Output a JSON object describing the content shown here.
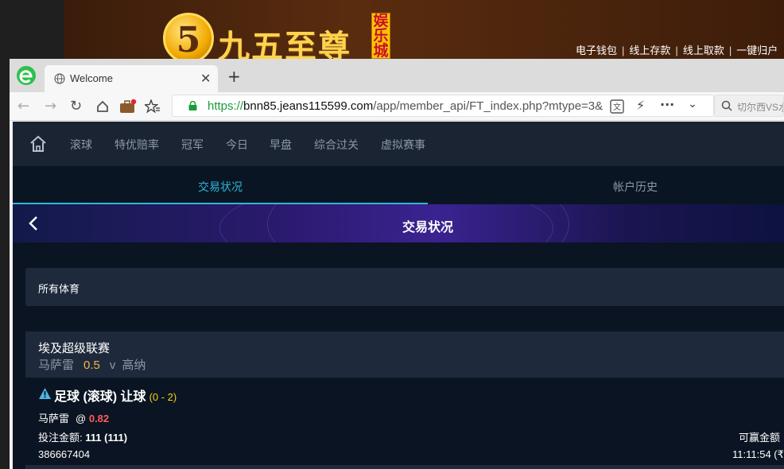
{
  "background_site": {
    "logo_numeral": "5",
    "logo_text": "九五至尊",
    "logo_badge": "娱乐城",
    "links": [
      "电子钱包",
      "线上存款",
      "线上取款",
      "一键归户"
    ]
  },
  "browser": {
    "tab_title": "Welcome",
    "url_scheme": "https://",
    "url_host": "bnn85.jeans115599.com",
    "url_path": "/app/member_api/FT_index.php?mtype=3&",
    "search_placeholder": "切尔西VS水"
  },
  "nav": {
    "items": [
      "滚球",
      "特优赔率",
      "冠军",
      "今日",
      "早盘",
      "综合过关",
      "虚拟赛事"
    ]
  },
  "tabs": {
    "active": "交易状况",
    "history": "帐户历史"
  },
  "header": {
    "title": "交易状况"
  },
  "filter": {
    "label": "所有体育"
  },
  "bet": {
    "league": "埃及超级联赛",
    "home_team": "马萨雷",
    "handicap": "0.5",
    "vs": "v",
    "away_team": "高纳",
    "title": "足球 (滚球) 让球",
    "score": "(0 - 2)",
    "selection": "马萨雷",
    "at": "@",
    "odds": "0.82",
    "stake_label": "投注金额:",
    "stake_value": "111 (111)",
    "ticket_id": "386667404",
    "win_label": "可赢金额",
    "time": "11:11:54 (₹"
  },
  "colors": {
    "page_bg": "#0b1422",
    "nav_bg": "#1a2433",
    "accent": "#2fb6d8",
    "odds_red": "#ff5c5c",
    "handicap_gold": "#f2b544",
    "score_yellow": "#f2d21b"
  }
}
